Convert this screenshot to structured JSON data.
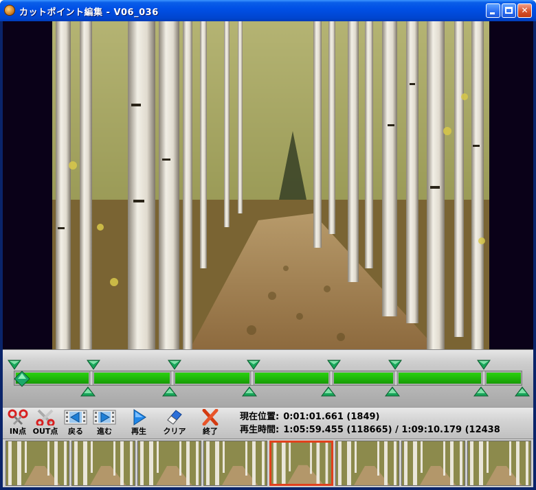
{
  "window": {
    "title": "カットポイント編集 - V06_036",
    "minimize_label": "",
    "maximize_label": "",
    "close_label": "✕"
  },
  "colors": {
    "accent_green": "#20b80a",
    "selected_thumb_border": "#e1401c",
    "titlebar": "#0050e6"
  },
  "timeline": {
    "cut_markers": 7,
    "segments": 7
  },
  "toolbar": {
    "in_point_label": "IN点",
    "out_point_label": "OUT点",
    "back_label": "戻る",
    "forward_label": "進む",
    "play_label": "再生",
    "clear_label": "クリア",
    "exit_label": "終了"
  },
  "info": {
    "position_label": "現在位置:",
    "position_value": "0:01:01.661 (1849)",
    "playtime_label": "再生時間:",
    "playtime_value": "1:05:59.455 (118665) / 1:09:10.179 (12438"
  },
  "thumbnails": {
    "count": 8,
    "selected_index": 4
  },
  "icons": {
    "app": "app-tiger-icon",
    "in_point": "scissors-red-icon",
    "out_point": "scissors-gray-icon",
    "back": "film-back-icon",
    "forward": "film-forward-icon",
    "play": "play-triangle-icon",
    "clear": "eraser-icon",
    "exit": "red-x-icon"
  }
}
